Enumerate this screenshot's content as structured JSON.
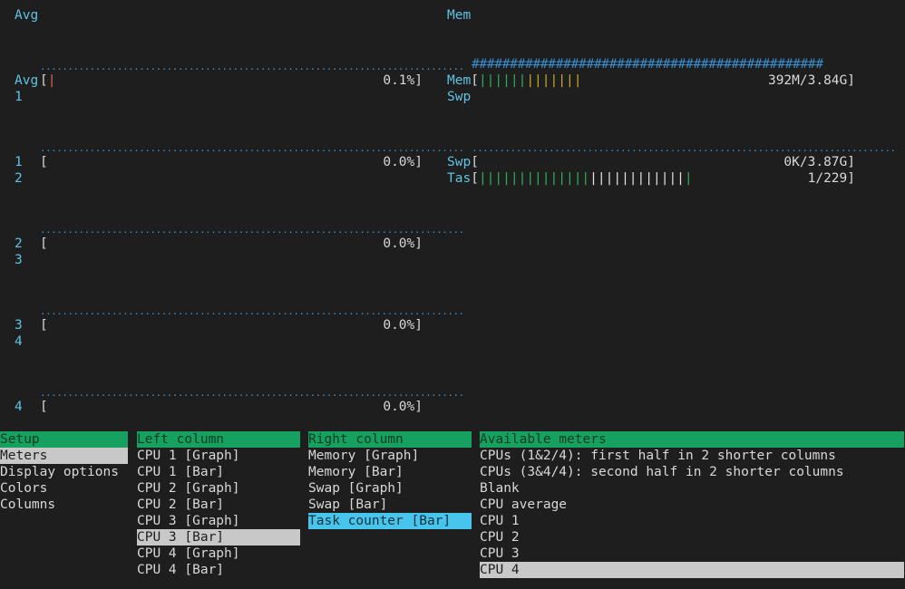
{
  "graphs": {
    "left_header": "Avg",
    "right_header": "Mem",
    "left": [
      {
        "graph_label_top": "Avg",
        "graph_label_bottom": "1",
        "bar_label": "Avg",
        "value": "0.1%"
      },
      {
        "graph_label_top": "1",
        "graph_label_bottom": "2",
        "bar_label": "1",
        "value": "0.0%"
      },
      {
        "graph_label_top": "2",
        "graph_label_bottom": "3",
        "bar_label": "2",
        "value": "0.0%"
      },
      {
        "graph_label_top": "3",
        "graph_label_bottom": "4",
        "bar_label": "3",
        "value": "0.0%"
      },
      {
        "graph_label_top": "4",
        "graph_label_bottom": "",
        "bar_label": "4",
        "value": "0.0%"
      }
    ],
    "mem": {
      "label": "Mem",
      "value": "392M/3.84G]",
      "next_label": "Swp"
    },
    "swp": {
      "label": "Swp",
      "value": "0K/3.87G]"
    },
    "tasks": {
      "label": "Tas",
      "value": "1/229]"
    }
  },
  "setup": {
    "header": "Setup",
    "items": [
      "Meters",
      "Display options",
      "Colors",
      "Columns"
    ],
    "selected": 0
  },
  "left_column": {
    "header": "Left column",
    "items": [
      "CPU 1 [Graph]",
      "CPU 1 [Bar]",
      "CPU 2 [Graph]",
      "CPU 2 [Bar]",
      "CPU 3 [Graph]",
      "CPU 3 [Bar]",
      "CPU 4 [Graph]",
      "CPU 4 [Bar]"
    ],
    "selected": 5
  },
  "right_column": {
    "header": "Right column",
    "items": [
      "Memory [Graph]",
      "Memory [Bar]",
      "Swap [Graph]",
      "Swap [Bar]",
      "Task counter [Bar]"
    ],
    "selected": 4
  },
  "available_meters": {
    "header": "Available meters",
    "items": [
      "CPUs (1&2/4): first half in 2 shorter columns",
      "CPUs (3&4/4): second half in 2 shorter columns",
      "Blank",
      "CPU average",
      "CPU 1",
      "CPU 2",
      "CPU 3",
      "CPU 4"
    ],
    "selected": 7
  },
  "colors": {
    "background": "#1e1e1e",
    "header_green": "#17a160",
    "highlight_cyan": "#48c5ec",
    "highlight_gray": "#c8c8c8",
    "label_cyan": "#5fc3e4"
  }
}
